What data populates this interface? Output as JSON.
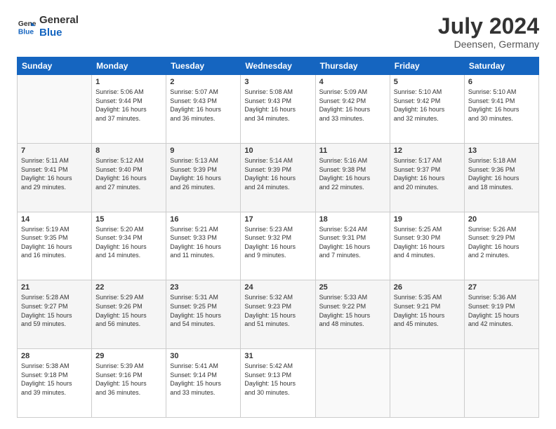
{
  "logo": {
    "line1": "General",
    "line2": "Blue"
  },
  "title": "July 2024",
  "subtitle": "Deensen, Germany",
  "weekdays": [
    "Sunday",
    "Monday",
    "Tuesday",
    "Wednesday",
    "Thursday",
    "Friday",
    "Saturday"
  ],
  "weeks": [
    [
      {
        "day": "",
        "info": ""
      },
      {
        "day": "1",
        "info": "Sunrise: 5:06 AM\nSunset: 9:44 PM\nDaylight: 16 hours\nand 37 minutes."
      },
      {
        "day": "2",
        "info": "Sunrise: 5:07 AM\nSunset: 9:43 PM\nDaylight: 16 hours\nand 36 minutes."
      },
      {
        "day": "3",
        "info": "Sunrise: 5:08 AM\nSunset: 9:43 PM\nDaylight: 16 hours\nand 34 minutes."
      },
      {
        "day": "4",
        "info": "Sunrise: 5:09 AM\nSunset: 9:42 PM\nDaylight: 16 hours\nand 33 minutes."
      },
      {
        "day": "5",
        "info": "Sunrise: 5:10 AM\nSunset: 9:42 PM\nDaylight: 16 hours\nand 32 minutes."
      },
      {
        "day": "6",
        "info": "Sunrise: 5:10 AM\nSunset: 9:41 PM\nDaylight: 16 hours\nand 30 minutes."
      }
    ],
    [
      {
        "day": "7",
        "info": "Sunrise: 5:11 AM\nSunset: 9:41 PM\nDaylight: 16 hours\nand 29 minutes."
      },
      {
        "day": "8",
        "info": "Sunrise: 5:12 AM\nSunset: 9:40 PM\nDaylight: 16 hours\nand 27 minutes."
      },
      {
        "day": "9",
        "info": "Sunrise: 5:13 AM\nSunset: 9:39 PM\nDaylight: 16 hours\nand 26 minutes."
      },
      {
        "day": "10",
        "info": "Sunrise: 5:14 AM\nSunset: 9:39 PM\nDaylight: 16 hours\nand 24 minutes."
      },
      {
        "day": "11",
        "info": "Sunrise: 5:16 AM\nSunset: 9:38 PM\nDaylight: 16 hours\nand 22 minutes."
      },
      {
        "day": "12",
        "info": "Sunrise: 5:17 AM\nSunset: 9:37 PM\nDaylight: 16 hours\nand 20 minutes."
      },
      {
        "day": "13",
        "info": "Sunrise: 5:18 AM\nSunset: 9:36 PM\nDaylight: 16 hours\nand 18 minutes."
      }
    ],
    [
      {
        "day": "14",
        "info": "Sunrise: 5:19 AM\nSunset: 9:35 PM\nDaylight: 16 hours\nand 16 minutes."
      },
      {
        "day": "15",
        "info": "Sunrise: 5:20 AM\nSunset: 9:34 PM\nDaylight: 16 hours\nand 14 minutes."
      },
      {
        "day": "16",
        "info": "Sunrise: 5:21 AM\nSunset: 9:33 PM\nDaylight: 16 hours\nand 11 minutes."
      },
      {
        "day": "17",
        "info": "Sunrise: 5:23 AM\nSunset: 9:32 PM\nDaylight: 16 hours\nand 9 minutes."
      },
      {
        "day": "18",
        "info": "Sunrise: 5:24 AM\nSunset: 9:31 PM\nDaylight: 16 hours\nand 7 minutes."
      },
      {
        "day": "19",
        "info": "Sunrise: 5:25 AM\nSunset: 9:30 PM\nDaylight: 16 hours\nand 4 minutes."
      },
      {
        "day": "20",
        "info": "Sunrise: 5:26 AM\nSunset: 9:29 PM\nDaylight: 16 hours\nand 2 minutes."
      }
    ],
    [
      {
        "day": "21",
        "info": "Sunrise: 5:28 AM\nSunset: 9:27 PM\nDaylight: 15 hours\nand 59 minutes."
      },
      {
        "day": "22",
        "info": "Sunrise: 5:29 AM\nSunset: 9:26 PM\nDaylight: 15 hours\nand 56 minutes."
      },
      {
        "day": "23",
        "info": "Sunrise: 5:31 AM\nSunset: 9:25 PM\nDaylight: 15 hours\nand 54 minutes."
      },
      {
        "day": "24",
        "info": "Sunrise: 5:32 AM\nSunset: 9:23 PM\nDaylight: 15 hours\nand 51 minutes."
      },
      {
        "day": "25",
        "info": "Sunrise: 5:33 AM\nSunset: 9:22 PM\nDaylight: 15 hours\nand 48 minutes."
      },
      {
        "day": "26",
        "info": "Sunrise: 5:35 AM\nSunset: 9:21 PM\nDaylight: 15 hours\nand 45 minutes."
      },
      {
        "day": "27",
        "info": "Sunrise: 5:36 AM\nSunset: 9:19 PM\nDaylight: 15 hours\nand 42 minutes."
      }
    ],
    [
      {
        "day": "28",
        "info": "Sunrise: 5:38 AM\nSunset: 9:18 PM\nDaylight: 15 hours\nand 39 minutes."
      },
      {
        "day": "29",
        "info": "Sunrise: 5:39 AM\nSunset: 9:16 PM\nDaylight: 15 hours\nand 36 minutes."
      },
      {
        "day": "30",
        "info": "Sunrise: 5:41 AM\nSunset: 9:14 PM\nDaylight: 15 hours\nand 33 minutes."
      },
      {
        "day": "31",
        "info": "Sunrise: 5:42 AM\nSunset: 9:13 PM\nDaylight: 15 hours\nand 30 minutes."
      },
      {
        "day": "",
        "info": ""
      },
      {
        "day": "",
        "info": ""
      },
      {
        "day": "",
        "info": ""
      }
    ]
  ]
}
